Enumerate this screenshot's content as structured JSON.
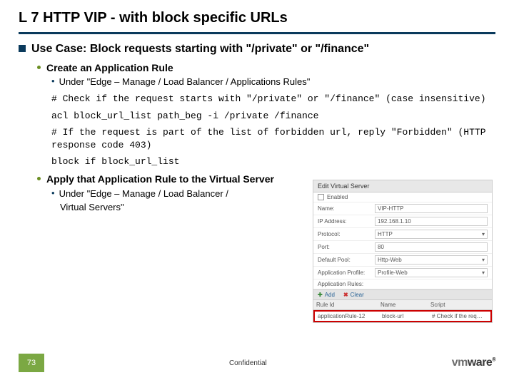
{
  "title": "L 7 HTTP VIP - with block specific URLs",
  "usecase": "Use Case: Block requests starting with \"/private\" or \"/finance\"",
  "createRule": "Create an Application Rule",
  "underRules": "Under \"Edge – Manage /  Load Balancer / Applications Rules\"",
  "code1a": "# Check if the request starts with \"/private\" or \"/finance\" (case insensitive)",
  "code1b": "acl block_url_list path_beg -i /private /finance",
  "code2a": "# If the request is part of the list of forbidden url, reply \"Forbidden\" (HTTP response code 403)",
  "code2b": "block if block_url_list",
  "applyRule": "Apply that Application Rule to the Virtual Server",
  "underVS": "Under \"Edge – Manage /  Load Balancer /",
  "underVS2": "Virtual Servers\"",
  "pageNum": "73",
  "confidential": "Confidential",
  "panel": {
    "header": "Edit Virtual Server",
    "enabled": "Enabled",
    "nameLbl": "Name:",
    "nameVal": "VIP-HTTP",
    "ipLbl": "IP Address:",
    "ipVal": "192.168.1.10",
    "protoLbl": "Protocol:",
    "protoVal": "HTTP",
    "portLbl": "Port:",
    "portVal": "80",
    "poolLbl": "Default Pool:",
    "poolVal": "Http-Web",
    "profLbl": "Application Profile:",
    "profVal": "Profile-Web",
    "rulesLbl": "Application Rules:",
    "add": "Add",
    "clear": "Clear",
    "col1": "Rule Id",
    "col2": "Name",
    "col3": "Script",
    "rowId": "applicationRule-12",
    "rowName": "block-url",
    "rowScript": "# Check if the req…"
  }
}
